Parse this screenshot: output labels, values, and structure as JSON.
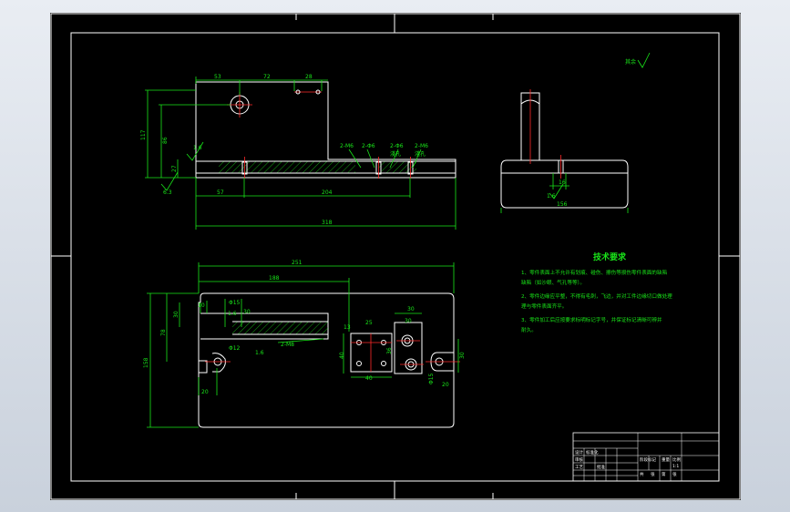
{
  "drawing": {
    "front_view": {
      "dims_top": [
        "53",
        "72",
        "28"
      ],
      "dims_left": [
        "117",
        "86",
        "27"
      ],
      "dims_bottom": [
        "57",
        "204",
        "318"
      ],
      "hole_labels": [
        "2-M6",
        "2-Φ6",
        "2-Φ6",
        "2-M6"
      ],
      "hole_sublabels": [
        "淺孔",
        "淺孔"
      ],
      "roughness": [
        "1.6",
        "6.3"
      ]
    },
    "side_view": {
      "dims": [
        "16",
        "156"
      ],
      "roughness": "1.6"
    },
    "plan_view": {
      "dims_top": [
        "251",
        "188"
      ],
      "dims_left": [
        "158",
        "78",
        "30",
        "20"
      ],
      "dims_inner": [
        "10",
        "Φ15",
        "1.6",
        "30",
        "Φ12",
        "2-M8",
        "1.6"
      ],
      "block_dims": [
        "13",
        "25",
        "40",
        "40",
        "30",
        "30",
        "36"
      ],
      "right_dims": [
        "30",
        "Φ15",
        "20"
      ]
    },
    "surface_finish_note": "其余"
  },
  "tech_requirements": {
    "title": "技术要求",
    "lines": [
      "1、零件表面上不允许有划痕、碰伤、擦伤等损伤零件表面的缺陷",
      "缺陷（如沙眼、气孔等等）。",
      "2、零件边缘应平整，不得有毛刺，飞边，并对工件边缘切口做处理",
      "理与零件表面齐平。",
      "3、零件加工后应按要求标明标记字号，并保证标记清晰可辨并",
      "耐久。"
    ]
  },
  "title_block": {
    "cells": [
      "设计",
      "标准化",
      "审核",
      "工艺",
      "批准",
      "阶段标记",
      "重量",
      "比例",
      "共",
      "张",
      "第",
      "张",
      "1:1"
    ]
  },
  "colors": {
    "background": "#000000",
    "frame": "#ffffff",
    "dimension": "#19e619",
    "centerline": "#ff2a2a",
    "window_bg": "#d4dbe5"
  }
}
